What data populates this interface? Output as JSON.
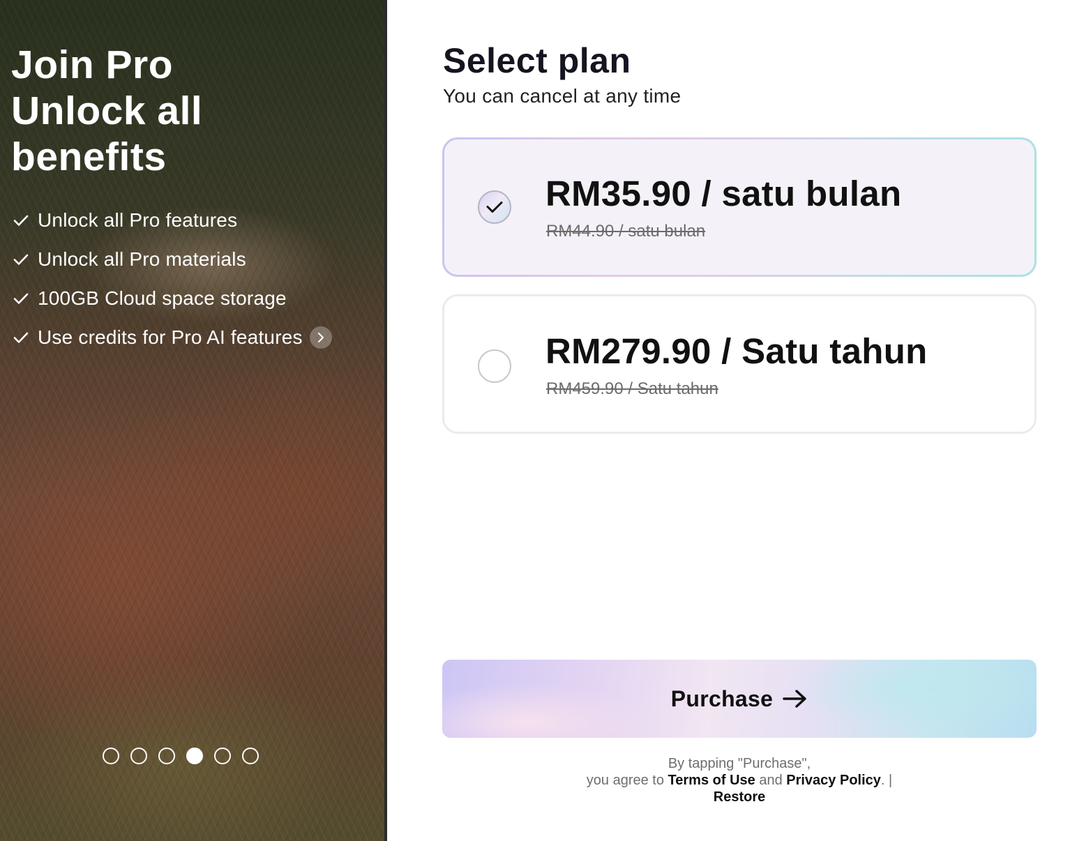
{
  "hero": {
    "title_lines": [
      "Join Pro",
      "Unlock all",
      "benefits"
    ],
    "benefits": [
      {
        "label": "Unlock all Pro features",
        "icon": "check-icon"
      },
      {
        "label": "Unlock all Pro materials",
        "icon": "check-icon"
      },
      {
        "label": "100GB Cloud space storage",
        "icon": "check-icon"
      },
      {
        "label": "Use credits for Pro AI features",
        "icon": "check-icon",
        "more_icon": "chevron-right-icon"
      }
    ],
    "carousel": {
      "total": 6,
      "active_index": 3
    }
  },
  "panel": {
    "title": "Select plan",
    "subtitle": "You can cancel at any time",
    "plans": [
      {
        "price": "RM35.90 / satu bulan",
        "original_price": "RM44.90 / satu bulan",
        "selected": true
      },
      {
        "price": "RM279.90 / Satu tahun",
        "original_price": "RM459.90 / Satu tahun",
        "selected": false
      }
    ],
    "purchase": {
      "label": "Purchase",
      "icon": "arrow-right-icon"
    },
    "legal": {
      "line1": "By tapping \"Purchase\",",
      "prefix": "you agree to ",
      "terms": "Terms of Use",
      "and": " and ",
      "privacy": "Privacy Policy",
      "suffix": ". |",
      "restore": "Restore"
    }
  },
  "colors": {
    "text_dark": "#151521",
    "muted": "#6e6e6e",
    "selected_card_bg": "#f4f2f8",
    "card_border": "#ebebeb",
    "gradient_start": "#cdc6f5",
    "gradient_end": "#b8def0"
  }
}
